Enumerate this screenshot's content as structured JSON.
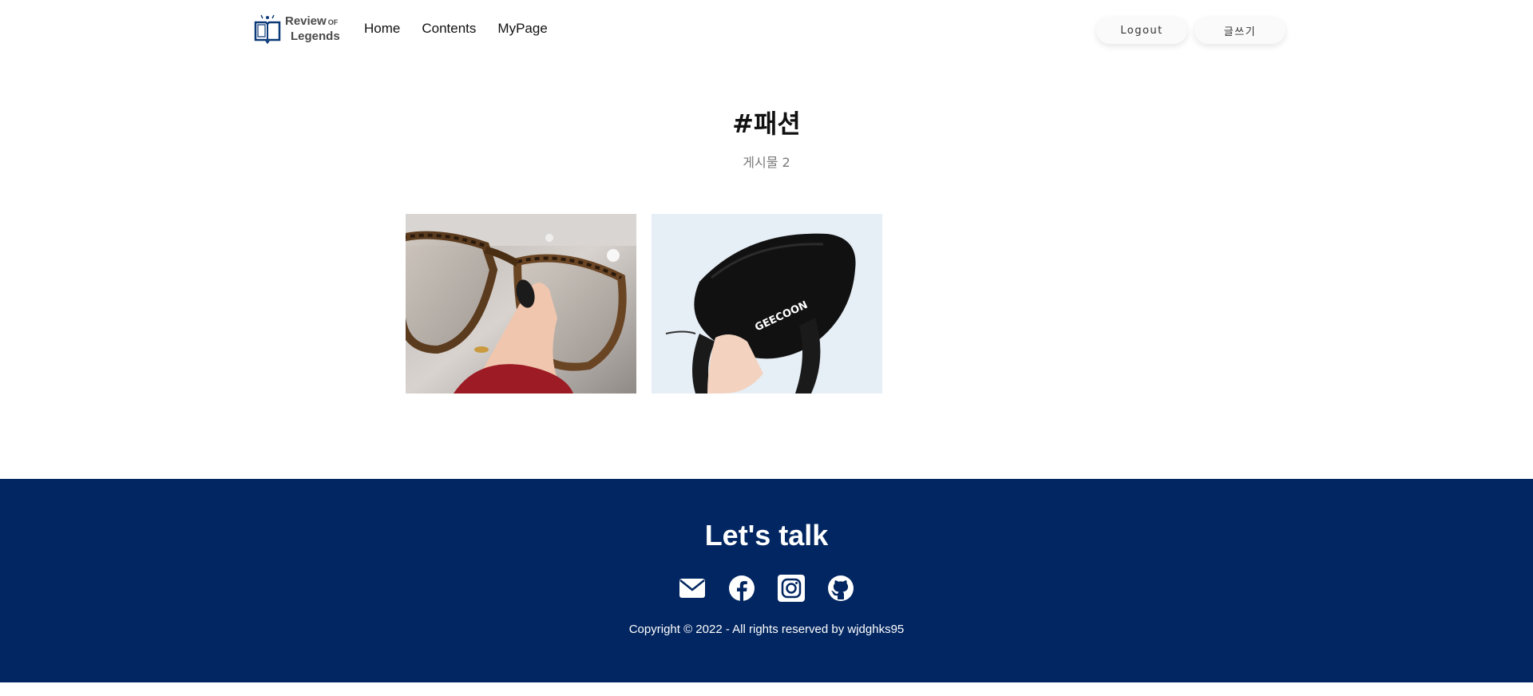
{
  "header": {
    "logo": {
      "line1": "Review",
      "of": "OF",
      "line2": "Legends"
    },
    "nav": [
      {
        "label": "Home"
      },
      {
        "label": "Contents"
      },
      {
        "label": "MyPage"
      }
    ],
    "logout_label": "Logout",
    "write_label": "글쓰기"
  },
  "main": {
    "tag_title": "#패션",
    "post_count": "게시물 2",
    "posts": [
      {
        "thumbnail": "glasses-photo"
      },
      {
        "thumbnail": "bag-photo",
        "brand_text": "GEECOON"
      }
    ]
  },
  "footer": {
    "title": "Let's talk",
    "icons": [
      "mail-icon",
      "facebook-icon",
      "instagram-icon",
      "github-icon"
    ],
    "copyright": "Copyright © 2022 - All rights reserved by wjdghks95"
  },
  "colors": {
    "footer_bg": "#022661",
    "logo_blue": "#0b3a78",
    "text_muted": "#7a7a7a"
  }
}
